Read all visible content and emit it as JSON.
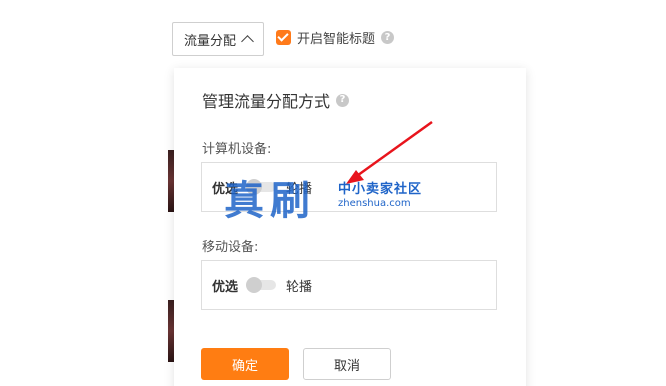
{
  "toolbar": {
    "traffic_dropdown_label": "流量分配",
    "smart_title_label": "开启智能标题",
    "smart_title_checked": true
  },
  "panel": {
    "title": "管理流量分配方式",
    "sections": [
      {
        "label": "计算机设备:",
        "option_left": "优选",
        "option_right": "轮播"
      },
      {
        "label": "移动设备:",
        "option_left": "优选",
        "option_right": "轮播"
      }
    ],
    "ok_label": "确定",
    "cancel_label": "取消"
  },
  "watermark": {
    "big_text": "真刷",
    "small_text": "中小卖家社区",
    "url_text": "zhenshua.com"
  },
  "colors": {
    "accent": "#ff7d12",
    "watermark": "#1f64c8",
    "arrow": "#e8141c"
  }
}
